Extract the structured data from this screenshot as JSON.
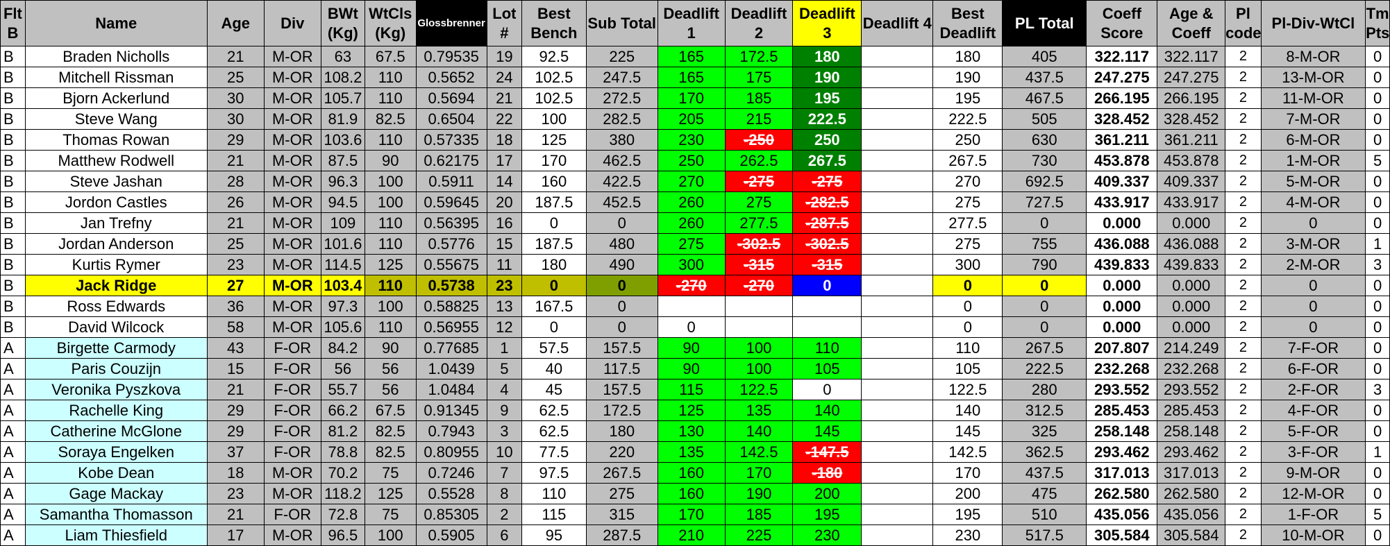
{
  "columns": [
    {
      "key": "flt",
      "label": "Flt B",
      "style": "grey"
    },
    {
      "key": "name",
      "label": "Name",
      "style": "grey"
    },
    {
      "key": "age",
      "label": "Age",
      "style": "grey"
    },
    {
      "key": "div",
      "label": "Div",
      "style": "grey"
    },
    {
      "key": "bwt",
      "label": "BWt (Kg)",
      "style": "grey"
    },
    {
      "key": "wtcls",
      "label": "WtCls (Kg)",
      "style": "grey"
    },
    {
      "key": "gloss",
      "label": "Glossbrenner",
      "style": "black"
    },
    {
      "key": "lot",
      "label": "Lot #",
      "style": "grey"
    },
    {
      "key": "bench",
      "label": "Best Bench",
      "style": "grey"
    },
    {
      "key": "subtotal",
      "label": "Sub Total",
      "style": "grey"
    },
    {
      "key": "dl1",
      "label": "Deadlift 1",
      "style": "grey"
    },
    {
      "key": "dl2",
      "label": "Deadlift 2",
      "style": "grey"
    },
    {
      "key": "dl3",
      "label": "Deadlift 3",
      "style": "yellow"
    },
    {
      "key": "dl4",
      "label": "Deadlift 4",
      "style": "grey"
    },
    {
      "key": "bestdl",
      "label": "Best Deadlift",
      "style": "grey"
    },
    {
      "key": "pltotal",
      "label": "PL Total",
      "style": "black"
    },
    {
      "key": "coeff",
      "label": "Coeff Score",
      "style": "grey"
    },
    {
      "key": "agecoeff",
      "label": "Age & Coeff",
      "style": "grey"
    },
    {
      "key": "plcode",
      "label": "Pl code",
      "style": "grey"
    },
    {
      "key": "pldiv",
      "label": "Pl-Div-WtCl",
      "style": "grey"
    },
    {
      "key": "tm",
      "label": "Tm Pts",
      "style": "grey"
    }
  ],
  "rows": [
    {
      "flt": "B",
      "name": "Braden Nicholls",
      "age": "21",
      "div": "M-OR",
      "bwt": "63",
      "wtcls": "67.5",
      "gloss": "0.79535",
      "lot": "19",
      "bench": "92.5",
      "subtotal": "225",
      "dl1": "165",
      "dl1s": "good",
      "dl2": "172.5",
      "dl2s": "good",
      "dl3": "180",
      "dl3s": "best",
      "dl4": "",
      "bestdl": "180",
      "pltotal": "405",
      "coeff": "322.117",
      "agecoeff": "322.117",
      "plcode": "2",
      "pldiv": "8-M-OR",
      "tm": "0"
    },
    {
      "flt": "B",
      "name": "Mitchell Rissman",
      "age": "25",
      "div": "M-OR",
      "bwt": "108.2",
      "wtcls": "110",
      "gloss": "0.5652",
      "lot": "24",
      "bench": "102.5",
      "subtotal": "247.5",
      "dl1": "165",
      "dl1s": "good",
      "dl2": "175",
      "dl2s": "good",
      "dl3": "190",
      "dl3s": "best",
      "dl4": "",
      "bestdl": "190",
      "pltotal": "437.5",
      "coeff": "247.275",
      "agecoeff": "247.275",
      "plcode": "2",
      "pldiv": "13-M-OR",
      "tm": "0"
    },
    {
      "flt": "B",
      "name": "Bjorn Ackerlund",
      "age": "30",
      "div": "M-OR",
      "bwt": "105.7",
      "wtcls": "110",
      "gloss": "0.5694",
      "lot": "21",
      "bench": "102.5",
      "subtotal": "272.5",
      "dl1": "170",
      "dl1s": "good",
      "dl2": "185",
      "dl2s": "good",
      "dl3": "195",
      "dl3s": "best",
      "dl4": "",
      "bestdl": "195",
      "pltotal": "467.5",
      "coeff": "266.195",
      "agecoeff": "266.195",
      "plcode": "2",
      "pldiv": "11-M-OR",
      "tm": "0"
    },
    {
      "flt": "B",
      "name": "Steve Wang",
      "age": "30",
      "div": "M-OR",
      "bwt": "81.9",
      "wtcls": "82.5",
      "gloss": "0.6504",
      "lot": "22",
      "bench": "100",
      "subtotal": "282.5",
      "dl1": "205",
      "dl1s": "good",
      "dl2": "215",
      "dl2s": "good",
      "dl3": "222.5",
      "dl3s": "best",
      "dl4": "",
      "bestdl": "222.5",
      "pltotal": "505",
      "coeff": "328.452",
      "agecoeff": "328.452",
      "plcode": "2",
      "pldiv": "7-M-OR",
      "tm": "0"
    },
    {
      "flt": "B",
      "name": "Thomas Rowan",
      "age": "29",
      "div": "M-OR",
      "bwt": "103.6",
      "wtcls": "110",
      "gloss": "0.57335",
      "lot": "18",
      "bench": "125",
      "subtotal": "380",
      "dl1": "230",
      "dl1s": "good",
      "dl2": "-250",
      "dl2s": "fail",
      "dl3": "250",
      "dl3s": "best",
      "dl4": "",
      "bestdl": "250",
      "pltotal": "630",
      "coeff": "361.211",
      "agecoeff": "361.211",
      "plcode": "2",
      "pldiv": "6-M-OR",
      "tm": "0"
    },
    {
      "flt": "B",
      "name": "Matthew Rodwell",
      "age": "21",
      "div": "M-OR",
      "bwt": "87.5",
      "wtcls": "90",
      "gloss": "0.62175",
      "lot": "17",
      "bench": "170",
      "subtotal": "462.5",
      "dl1": "250",
      "dl1s": "good",
      "dl2": "262.5",
      "dl2s": "good",
      "dl3": "267.5",
      "dl3s": "best",
      "dl4": "",
      "bestdl": "267.5",
      "pltotal": "730",
      "coeff": "453.878",
      "agecoeff": "453.878",
      "plcode": "2",
      "pldiv": "1-M-OR",
      "tm": "5"
    },
    {
      "flt": "B",
      "name": "Steve Jashan",
      "age": "28",
      "div": "M-OR",
      "bwt": "96.3",
      "wtcls": "100",
      "gloss": "0.5911",
      "lot": "14",
      "bench": "160",
      "subtotal": "422.5",
      "dl1": "270",
      "dl1s": "good",
      "dl2": "-275",
      "dl2s": "fail",
      "dl3": "-275",
      "dl3s": "fail",
      "dl4": "",
      "bestdl": "270",
      "pltotal": "692.5",
      "coeff": "409.337",
      "agecoeff": "409.337",
      "plcode": "2",
      "pldiv": "5-M-OR",
      "tm": "0"
    },
    {
      "flt": "B",
      "name": "Jordon Castles",
      "age": "26",
      "div": "M-OR",
      "bwt": "94.5",
      "wtcls": "100",
      "gloss": "0.59645",
      "lot": "20",
      "bench": "187.5",
      "subtotal": "452.5",
      "dl1": "260",
      "dl1s": "good",
      "dl2": "275",
      "dl2s": "good",
      "dl3": "-282.5",
      "dl3s": "fail",
      "dl4": "",
      "bestdl": "275",
      "pltotal": "727.5",
      "coeff": "433.917",
      "agecoeff": "433.917",
      "plcode": "2",
      "pldiv": "4-M-OR",
      "tm": "0"
    },
    {
      "flt": "B",
      "name": "Jan Trefny",
      "age": "21",
      "div": "M-OR",
      "bwt": "109",
      "wtcls": "110",
      "gloss": "0.56395",
      "lot": "16",
      "bench": "0",
      "subtotal": "0",
      "dl1": "260",
      "dl1s": "good",
      "dl2": "277.5",
      "dl2s": "good",
      "dl3": "-287.5",
      "dl3s": "fail",
      "dl4": "",
      "bestdl": "277.5",
      "pltotal": "0",
      "coeff": "0.000",
      "agecoeff": "0.000",
      "plcode": "2",
      "pldiv": "0",
      "tm": "0"
    },
    {
      "flt": "B",
      "name": "Jordan Anderson",
      "age": "25",
      "div": "M-OR",
      "bwt": "101.6",
      "wtcls": "110",
      "gloss": "0.5776",
      "lot": "15",
      "bench": "187.5",
      "subtotal": "480",
      "dl1": "275",
      "dl1s": "good",
      "dl2": "-302.5",
      "dl2s": "fail",
      "dl3": "-302.5",
      "dl3s": "fail",
      "dl4": "",
      "bestdl": "275",
      "pltotal": "755",
      "coeff": "436.088",
      "agecoeff": "436.088",
      "plcode": "2",
      "pldiv": "3-M-OR",
      "tm": "1"
    },
    {
      "flt": "B",
      "name": "Kurtis Rymer",
      "age": "23",
      "div": "M-OR",
      "bwt": "114.5",
      "wtcls": "125",
      "gloss": "0.55675",
      "lot": "11",
      "bench": "180",
      "subtotal": "490",
      "dl1": "300",
      "dl1s": "good",
      "dl2": "-315",
      "dl2s": "fail",
      "dl3": "-315",
      "dl3s": "fail",
      "dl4": "",
      "bestdl": "300",
      "pltotal": "790",
      "coeff": "439.833",
      "agecoeff": "439.833",
      "plcode": "2",
      "pldiv": "2-M-OR",
      "tm": "3"
    },
    {
      "flt": "B",
      "name": "Jack Ridge",
      "age": "27",
      "div": "M-OR",
      "bwt": "103.4",
      "wtcls": "110",
      "gloss": "0.5738",
      "lot": "23",
      "bench": "0",
      "subtotal": "0",
      "dl1": "-270",
      "dl1s": "fail",
      "dl2": "-270",
      "dl2s": "fail",
      "dl3": "0",
      "dl3s": "none",
      "dl4": "",
      "bestdl": "0",
      "pltotal": "0",
      "coeff": "0.000",
      "agecoeff": "0.000",
      "plcode": "2",
      "pldiv": "0",
      "tm": "0",
      "current": true
    },
    {
      "flt": "B",
      "name": "Ross Edwards",
      "age": "36",
      "div": "M-OR",
      "bwt": "97.3",
      "wtcls": "100",
      "gloss": "0.58825",
      "lot": "13",
      "bench": "167.5",
      "subtotal": "0",
      "dl1": "",
      "dl1s": "empty",
      "dl2": "",
      "dl2s": "empty",
      "dl3": "",
      "dl3s": "empty",
      "dl4": "",
      "bestdl": "0",
      "pltotal": "0",
      "coeff": "0.000",
      "agecoeff": "0.000",
      "plcode": "2",
      "pldiv": "0",
      "tm": "0"
    },
    {
      "flt": "B",
      "name": "David Wilcock",
      "age": "58",
      "div": "M-OR",
      "bwt": "105.6",
      "wtcls": "110",
      "gloss": "0.56955",
      "lot": "12",
      "bench": "0",
      "subtotal": "0",
      "dl1": "0",
      "dl1s": "empty",
      "dl2": "",
      "dl2s": "empty",
      "dl3": "",
      "dl3s": "empty",
      "dl4": "",
      "bestdl": "0",
      "pltotal": "0",
      "coeff": "0.000",
      "agecoeff": "0.000",
      "plcode": "2",
      "pldiv": "0",
      "tm": "0"
    },
    {
      "flt": "A",
      "name": "Birgette Carmody",
      "age": "43",
      "div": "F-OR",
      "bwt": "84.2",
      "wtcls": "90",
      "gloss": "0.77685",
      "lot": "1",
      "bench": "57.5",
      "subtotal": "157.5",
      "dl1": "90",
      "dl1s": "good",
      "dl2": "100",
      "dl2s": "good",
      "dl3": "110",
      "dl3s": "good",
      "dl4": "",
      "bestdl": "110",
      "pltotal": "267.5",
      "coeff": "207.807",
      "agecoeff": "214.249",
      "plcode": "2",
      "pldiv": "7-F-OR",
      "tm": "0"
    },
    {
      "flt": "A",
      "name": "Paris Couzijn",
      "age": "15",
      "div": "F-OR",
      "bwt": "56",
      "wtcls": "56",
      "gloss": "1.0439",
      "lot": "5",
      "bench": "40",
      "subtotal": "117.5",
      "dl1": "90",
      "dl1s": "good",
      "dl2": "100",
      "dl2s": "good",
      "dl3": "105",
      "dl3s": "good",
      "dl4": "",
      "bestdl": "105",
      "pltotal": "222.5",
      "coeff": "232.268",
      "agecoeff": "232.268",
      "plcode": "2",
      "pldiv": "6-F-OR",
      "tm": "0"
    },
    {
      "flt": "A",
      "name": "Veronika Pyszkova",
      "age": "21",
      "div": "F-OR",
      "bwt": "55.7",
      "wtcls": "56",
      "gloss": "1.0484",
      "lot": "4",
      "bench": "45",
      "subtotal": "157.5",
      "dl1": "115",
      "dl1s": "good",
      "dl2": "122.5",
      "dl2s": "good",
      "dl3": "0",
      "dl3s": "empty",
      "dl4": "",
      "bestdl": "122.5",
      "pltotal": "280",
      "coeff": "293.552",
      "agecoeff": "293.552",
      "plcode": "2",
      "pldiv": "2-F-OR",
      "tm": "3"
    },
    {
      "flt": "A",
      "name": "Rachelle King",
      "age": "29",
      "div": "F-OR",
      "bwt": "66.2",
      "wtcls": "67.5",
      "gloss": "0.91345",
      "lot": "9",
      "bench": "62.5",
      "subtotal": "172.5",
      "dl1": "125",
      "dl1s": "good",
      "dl2": "135",
      "dl2s": "good",
      "dl3": "140",
      "dl3s": "good",
      "dl4": "",
      "bestdl": "140",
      "pltotal": "312.5",
      "coeff": "285.453",
      "agecoeff": "285.453",
      "plcode": "2",
      "pldiv": "4-F-OR",
      "tm": "0"
    },
    {
      "flt": "A",
      "name": "Catherine McGlone",
      "age": "29",
      "div": "F-OR",
      "bwt": "81.2",
      "wtcls": "82.5",
      "gloss": "0.7943",
      "lot": "3",
      "bench": "62.5",
      "subtotal": "180",
      "dl1": "130",
      "dl1s": "good",
      "dl2": "140",
      "dl2s": "good",
      "dl3": "145",
      "dl3s": "good",
      "dl4": "",
      "bestdl": "145",
      "pltotal": "325",
      "coeff": "258.148",
      "agecoeff": "258.148",
      "plcode": "2",
      "pldiv": "5-F-OR",
      "tm": "0"
    },
    {
      "flt": "A",
      "name": "Soraya Engelken",
      "age": "37",
      "div": "F-OR",
      "bwt": "78.8",
      "wtcls": "82.5",
      "gloss": "0.80955",
      "lot": "10",
      "bench": "77.5",
      "subtotal": "220",
      "dl1": "135",
      "dl1s": "good",
      "dl2": "142.5",
      "dl2s": "good",
      "dl3": "-147.5",
      "dl3s": "fail",
      "dl4": "",
      "bestdl": "142.5",
      "pltotal": "362.5",
      "coeff": "293.462",
      "agecoeff": "293.462",
      "plcode": "2",
      "pldiv": "3-F-OR",
      "tm": "1"
    },
    {
      "flt": "A",
      "name": "Kobe Dean",
      "age": "18",
      "div": "M-OR",
      "bwt": "70.2",
      "wtcls": "75",
      "gloss": "0.7246",
      "lot": "7",
      "bench": "97.5",
      "subtotal": "267.5",
      "dl1": "160",
      "dl1s": "good",
      "dl2": "170",
      "dl2s": "good",
      "dl3": "-180",
      "dl3s": "fail",
      "dl4": "",
      "bestdl": "170",
      "pltotal": "437.5",
      "coeff": "317.013",
      "agecoeff": "317.013",
      "plcode": "2",
      "pldiv": "9-M-OR",
      "tm": "0"
    },
    {
      "flt": "A",
      "name": "Gage Mackay",
      "age": "23",
      "div": "M-OR",
      "bwt": "118.2",
      "wtcls": "125",
      "gloss": "0.5528",
      "lot": "8",
      "bench": "110",
      "subtotal": "275",
      "dl1": "160",
      "dl1s": "good",
      "dl2": "190",
      "dl2s": "good",
      "dl3": "200",
      "dl3s": "good",
      "dl4": "",
      "bestdl": "200",
      "pltotal": "475",
      "coeff": "262.580",
      "agecoeff": "262.580",
      "plcode": "2",
      "pldiv": "12-M-OR",
      "tm": "0"
    },
    {
      "flt": "A",
      "name": "Samantha Thomasson",
      "age": "21",
      "div": "F-OR",
      "bwt": "72.8",
      "wtcls": "75",
      "gloss": "0.85305",
      "lot": "2",
      "bench": "115",
      "subtotal": "315",
      "dl1": "170",
      "dl1s": "good",
      "dl2": "185",
      "dl2s": "good",
      "dl3": "195",
      "dl3s": "good",
      "dl4": "",
      "bestdl": "195",
      "pltotal": "510",
      "coeff": "435.056",
      "agecoeff": "435.056",
      "plcode": "2",
      "pldiv": "1-F-OR",
      "tm": "5"
    },
    {
      "flt": "A",
      "name": "Liam Thiesfield",
      "age": "17",
      "div": "M-OR",
      "bwt": "96.5",
      "wtcls": "100",
      "gloss": "0.5905",
      "lot": "6",
      "bench": "95",
      "subtotal": "287.5",
      "dl1": "210",
      "dl1s": "good",
      "dl2": "225",
      "dl2s": "good",
      "dl3": "230",
      "dl3s": "good",
      "dl4": "",
      "bestdl": "230",
      "pltotal": "517.5",
      "coeff": "305.584",
      "agecoeff": "305.584",
      "plcode": "2",
      "pldiv": "10-M-OR",
      "tm": "0"
    }
  ]
}
